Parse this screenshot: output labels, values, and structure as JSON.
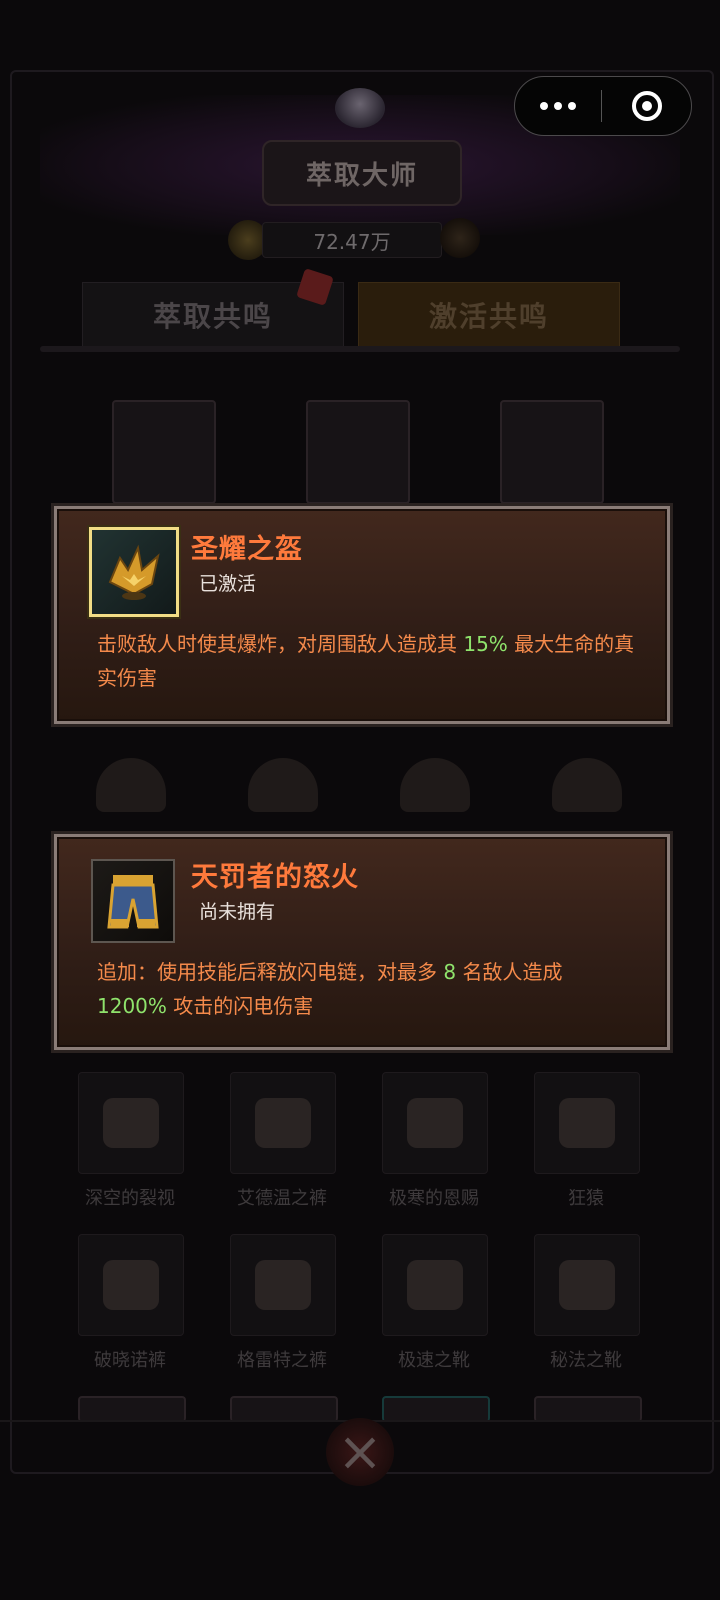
{
  "header": {
    "title": "萃取大师",
    "currency": "72.47万"
  },
  "tabs": [
    {
      "label": "萃取共鸣"
    },
    {
      "label": "激活共鸣"
    }
  ],
  "background_items": [
    {
      "label": "深空的裂视"
    },
    {
      "label": "艾德温之裤"
    },
    {
      "label": "极寒的恩赐"
    },
    {
      "label": "狂猿"
    },
    {
      "label": "破晓诺裤"
    },
    {
      "label": "格雷特之裤"
    },
    {
      "label": "极速之靴"
    },
    {
      "label": "秘法之靴"
    }
  ],
  "popups": [
    {
      "title": "圣耀之盔",
      "status": "已激活",
      "desc_1": "击败敌人时使其爆炸，对周围敌人造成其 ",
      "value_1": "15%",
      "desc_2": " 最大生命的真实伤害"
    },
    {
      "title": "天罚者的怒火",
      "status": "尚未拥有",
      "desc_1": "追加：使用技能后释放闪电链，对最多 ",
      "value_1": "8",
      "desc_2": " 名敌人造成 ",
      "value_2": "1200%",
      "desc_3": " 攻击的闪电伤害"
    }
  ],
  "icons": {
    "capsule_more": "more-dots-icon",
    "capsule_close": "close-miniprogram-icon",
    "bottom_close": "close-x-icon"
  },
  "colors": {
    "title": "#ff7a3c",
    "desc": "#f58a4b",
    "highlight": "#8fe36c",
    "popup_border": "#8a7c77"
  }
}
